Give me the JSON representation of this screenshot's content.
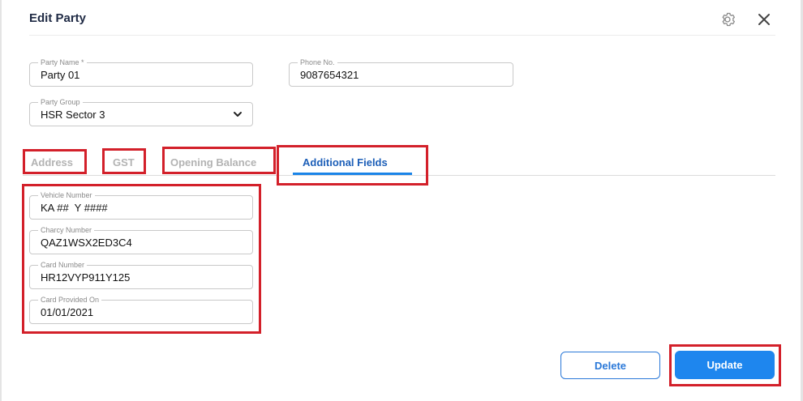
{
  "dialog": {
    "title": "Edit Party",
    "icons": {
      "settings": "gear-icon",
      "close": "close-icon"
    }
  },
  "fields": {
    "party_name": {
      "label": "Party Name *",
      "value": "Party 01"
    },
    "phone": {
      "label": "Phone No.",
      "value": "9087654321"
    },
    "party_group": {
      "label": "Party Group",
      "value": "HSR Sector 3"
    }
  },
  "tabs": [
    {
      "label": "Address",
      "active": false
    },
    {
      "label": "GST",
      "active": false
    },
    {
      "label": "Opening Balance",
      "active": false
    },
    {
      "label": "Additional Fields",
      "active": true
    }
  ],
  "additional_fields": [
    {
      "label": "Vehicle Number",
      "value": "KA ##  Y ####"
    },
    {
      "label": "Charcy Number",
      "value": "QAZ1WSX2ED3C4"
    },
    {
      "label": "Card Number",
      "value": "HR12VYP911Y125"
    },
    {
      "label": "Card Provided On",
      "value": "01/01/2021"
    }
  ],
  "actions": {
    "delete_label": "Delete",
    "update_label": "Update"
  },
  "colors": {
    "accent": "#1e86ee",
    "active_tab_text": "#1d5fb8",
    "highlight": "#d3202a",
    "inactive_tab_text": "#b3b3b3"
  }
}
